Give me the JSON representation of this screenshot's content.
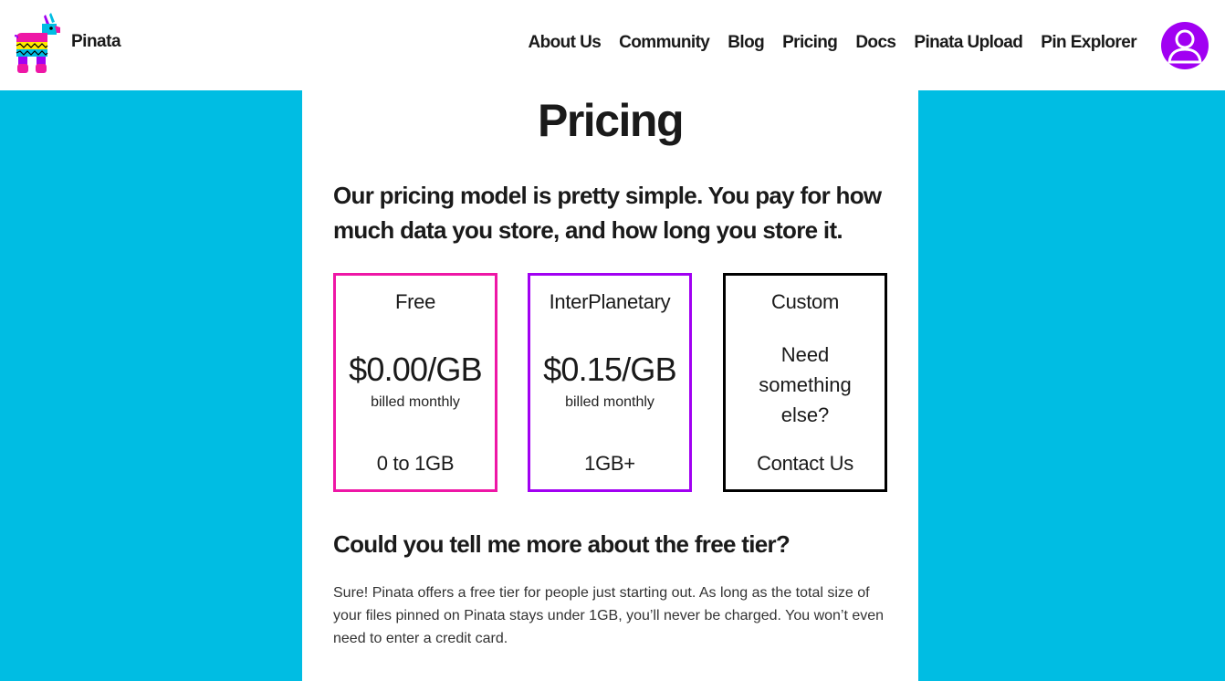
{
  "header": {
    "brand_name": "Pinata",
    "logo_icon": "pinata-llama-icon",
    "nav": [
      {
        "label": "About Us"
      },
      {
        "label": "Community"
      },
      {
        "label": "Blog"
      },
      {
        "label": "Pricing"
      },
      {
        "label": "Docs"
      },
      {
        "label": "Pinata Upload"
      },
      {
        "label": "Pin Explorer"
      }
    ],
    "avatar_icon": "user-avatar-icon"
  },
  "main": {
    "title": "Pricing",
    "intro": "Our pricing model is pretty simple. You pay for how much data you store, and how long you store it.",
    "plans": [
      {
        "name": "Free",
        "price": "$0.00/GB",
        "billing": "billed monthly",
        "range": "0 to 1GB"
      },
      {
        "name": "InterPlanetary",
        "price": "$0.15/GB",
        "billing": "billed monthly",
        "range": "1GB+"
      }
    ],
    "custom_plan": {
      "name": "Custom",
      "question": "Need something else?",
      "cta": "Contact Us"
    },
    "faq": {
      "heading": "Could you tell me more about the free tier?",
      "body": "Sure! Pinata offers a free tier for people just starting out. As long as the total size of your files pinned on Pinata stays under 1GB, you’ll never be charged. You won’t even need to enter a credit card."
    }
  },
  "colors": {
    "background": "#00bde3",
    "free_border": "#ee17a6",
    "interplanetary_border": "#a100f2",
    "custom_border": "#000000",
    "avatar": "#a100f2"
  }
}
